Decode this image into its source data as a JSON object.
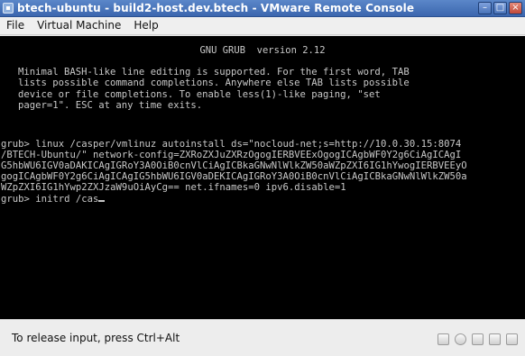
{
  "window": {
    "title": "btech-ubuntu - build2-host.dev.btech - VMware Remote Console",
    "controls": [
      "minimize-icon",
      "maximize-icon",
      "close-icon"
    ],
    "accent": "#3b66ae"
  },
  "menu": {
    "items": [
      {
        "label": "File"
      },
      {
        "label": "Virtual Machine"
      },
      {
        "label": "Help"
      }
    ]
  },
  "console": {
    "header": "GNU GRUB  version 2.12",
    "intro": [
      "Minimal BASH-like line editing is supported. For the first word, TAB",
      "lists possible command completions. Anywhere else TAB lists possible",
      "device or file completions. To enable less(1)-like paging, \"set",
      "pager=1\". ESC at any time exits."
    ],
    "lines": [
      "grub> linux /casper/vmlinuz autoinstall ds=\"nocloud-net;s=http://10.0.30.15:8074",
      "/BTECH-Ubuntu/\" network-config=ZXRoZXJuZXRzOgogIERBVEExOgogICAgbWF0Y2g6CiAgICAgI",
      "G5hbWU6IGV0aDAKICAgIGRoY3A0OiB0cnVlCiAgICBkaGNwNlWlkZW50aWZpZXI6IG1hYwogIERBVEEyO",
      "gogICAgbWF0Y2g6CiAgICAgIG5hbWU6IGV0aDEKICAgIGRoY3A0OiB0cnVlCiAgICBkaGNwNlWlkZW50a",
      "WZpZXI6IG1hYwp2ZXJzaW9uOiAyCg== net.ifnames=0 ipv6.disable=1"
    ],
    "prompt_line": "grub> initrd /cas"
  },
  "status": {
    "text": "To release input, press Ctrl+Alt",
    "icons": [
      "hard-disk-icon",
      "cd-rom-icon",
      "network-icon",
      "usb-icon",
      "sound-icon"
    ]
  }
}
